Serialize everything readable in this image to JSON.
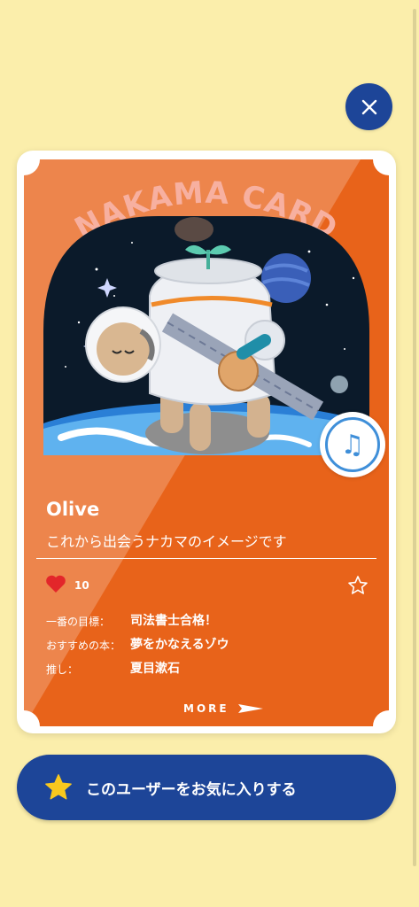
{
  "card": {
    "title": "NAKAMA CARD",
    "name": "Olive",
    "subtitle": "これから出会うナカマのイメージです",
    "likes": "10",
    "fields": [
      {
        "label": "一番の目標：",
        "value": "司法書士合格！"
      },
      {
        "label": "おすすめの本：",
        "value": "夢をかなえるゾウ"
      },
      {
        "label": "推し：",
        "value": "夏目漱石"
      }
    ],
    "more_label": "MORE"
  },
  "favorite_button": {
    "label": "このユーザーをお気に入りする"
  },
  "icons": {
    "close": "close-icon",
    "music": "music-note-icon",
    "heart": "heart-icon",
    "star_outline": "star-outline-icon",
    "star_filled": "star-icon",
    "arrow": "arrow-right-icon"
  },
  "colors": {
    "background": "#fbeeab",
    "card": "#e8631a",
    "primary_blue": "#1d4598",
    "heart_red": "#e3262a",
    "star_yellow": "#f8c81e"
  }
}
